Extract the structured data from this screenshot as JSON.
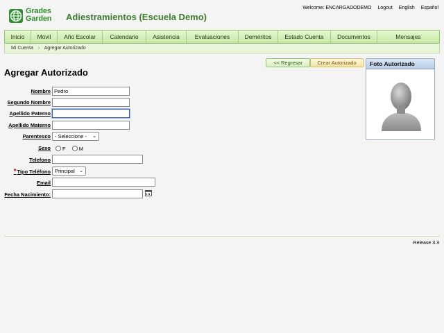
{
  "header": {
    "logo_line1": "Grades",
    "logo_line2": "Garden",
    "app_title": "Adiestramientos (Escuela Demo)",
    "welcome": "Welcome: ENCARGADODEMO",
    "logout": "Logout",
    "lang_en": "English",
    "lang_es": "Español"
  },
  "nav": [
    "Inicio",
    "Móvil",
    "Año Escolar",
    "Calendario",
    "Asistencia",
    "Evaluaciones",
    "Deméritos",
    "Estado Cuenta",
    "Documentos",
    "Mensajes"
  ],
  "breadcrumb": {
    "home": "Mi Cuenta",
    "separator": "›",
    "current": "Agregar Autorizado"
  },
  "page": {
    "title": "Agregar Autorizado",
    "back_button": "<< Regresar",
    "create_button": "Crear Autorizado"
  },
  "photo": {
    "title": "Foto Autorizado"
  },
  "form": {
    "nombre_label": "Nombre",
    "nombre_value": "Pedro",
    "segundo_label": "Segundo Nombre",
    "segundo_value": "",
    "paterno_label": "Apellido Paterno",
    "paterno_value": "",
    "materno_label": "Apellido Materno",
    "materno_value": "",
    "parentesco_label": "Parentesco",
    "parentesco_value": "- Seleccione -",
    "sexo_label": "Sexo",
    "sexo_f": "F",
    "sexo_m": "M",
    "telefono_label": "Telefono",
    "telefono_value": "",
    "required_mark": "*",
    "tipo_label": "Tipo Teléfono",
    "tipo_value": "Principal",
    "email_label": "Email",
    "email_value": "",
    "fecha_label": "Fecha Nacimiento:",
    "fecha_value": ""
  },
  "footer": {
    "release": "Release 3.3"
  },
  "colors": {
    "brand_green": "#3a7d2c",
    "nav_bg": "#c7e8a6",
    "photo_header": "#b6cde8"
  }
}
